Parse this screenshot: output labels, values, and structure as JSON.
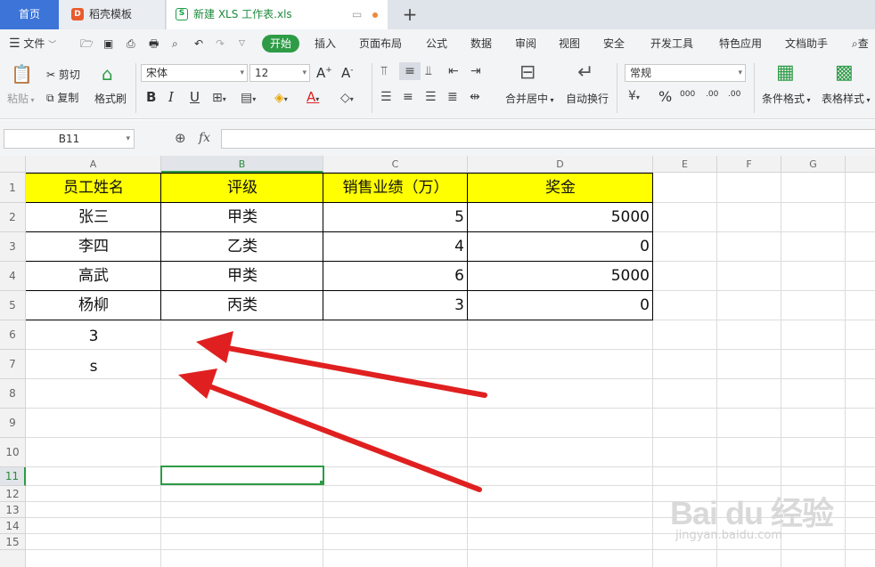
{
  "tabs": {
    "home": "首页",
    "template": "稻壳模板",
    "file": "新建 XLS 工作表.xls"
  },
  "menu": {
    "file": "文件",
    "items": [
      "开始",
      "插入",
      "页面布局",
      "公式",
      "数据",
      "审阅",
      "视图",
      "安全",
      "开发工具",
      "特色应用",
      "文档助手"
    ],
    "search_partial": "查"
  },
  "ribbon": {
    "paste": "粘贴",
    "cut": "剪切",
    "copy": "复制",
    "format_painter": "格式刷",
    "font_name": "宋体",
    "font_size": "12",
    "merge_center": "合并居中",
    "wrap_text": "自动换行",
    "number_format": "常规",
    "conditional_format": "条件格式",
    "table_style": "表格样式",
    "bold": "B",
    "italic": "I",
    "underline": "U",
    "percent": "%",
    "thousands": "000",
    "inc_decimal": ".00",
    "dec_decimal": ".00"
  },
  "formula_bar": {
    "name_box": "B11",
    "fx": "fx",
    "value": ""
  },
  "columns": [
    "A",
    "B",
    "C",
    "D",
    "E",
    "F",
    "G"
  ],
  "rows": [
    "1",
    "2",
    "3",
    "4",
    "5",
    "6",
    "7",
    "8",
    "9",
    "10",
    "11",
    "12",
    "13",
    "14",
    "15"
  ],
  "table": {
    "headers": [
      "员工姓名",
      "评级",
      "销售业绩（万）",
      "奖金"
    ],
    "rows": [
      [
        "张三",
        "甲类",
        "5",
        "5000"
      ],
      [
        "李四",
        "乙类",
        "4",
        "0"
      ],
      [
        "高武",
        "甲类",
        "6",
        "5000"
      ],
      [
        "杨柳",
        "丙类",
        "3",
        "0"
      ]
    ]
  },
  "extra_cells": {
    "a6": "3",
    "a7": "s"
  },
  "selected_cell": "B11",
  "colors": {
    "accent_green": "#2e9b46",
    "header_fill": "#ffff00",
    "arrow_red": "#e02020",
    "tab_blue": "#3d74d8"
  },
  "watermark": {
    "brand": "Bai du 经验",
    "url": "jingyan.baidu.com"
  }
}
